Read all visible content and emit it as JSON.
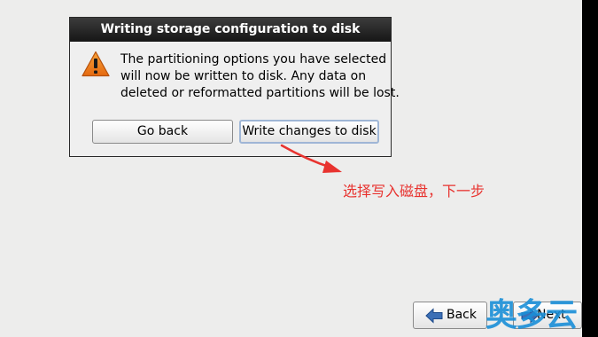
{
  "dialog": {
    "title": "Writing storage configuration to disk",
    "message_lines": [
      "The partitioning options you have selected",
      "will now be written to disk.  Any data on",
      "deleted or reformatted partitions will be lost."
    ],
    "go_back_label": "Go back",
    "write_changes_label": "Write changes to disk"
  },
  "navigation": {
    "back_label": "Back",
    "next_label": "Next"
  },
  "annotation": {
    "text": "选择写入磁盘，下一步",
    "color": "#e8332f"
  },
  "watermark": {
    "text": "奥多云",
    "color": "#1a8fd8"
  },
  "icons": {
    "warning": "warning-icon",
    "back": "back-arrow-icon",
    "next": "next-arrow-icon"
  }
}
